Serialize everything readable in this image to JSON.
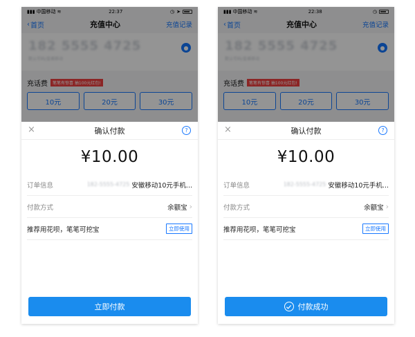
{
  "status_bar": {
    "carrier": "中国移动",
    "signal": "📶"
  },
  "nav": {
    "back_label": "首页",
    "title": "充值中心",
    "right_label": "充值记录"
  },
  "account": {
    "phone_masked": "182 5555 4725",
    "sub_text": "默认号码/皇甫移动"
  },
  "recharge": {
    "label": "充话费",
    "promo": "笔笔有惊喜 抽100元红包!"
  },
  "amount_tiles": [
    "10元",
    "20元",
    "30元"
  ],
  "sheet": {
    "title": "确认付款",
    "amount": "¥10.00",
    "order_label": "订单信息",
    "order_phone": "182-5555-4725",
    "order_value": "安徽移动10元手机...",
    "method_label": "付款方式",
    "method_value": "余额宝",
    "recommend_text": "推荐用花呗，笔笔可挖宝",
    "recommend_button": "立即使用"
  },
  "screens": [
    {
      "time": "22:37",
      "button_label": "立即付款"
    },
    {
      "time": "22:38",
      "button_label": "付款成功"
    }
  ],
  "colors": {
    "accent": "#1677ff",
    "button": "#1a8cee",
    "promo": "#f04040"
  }
}
